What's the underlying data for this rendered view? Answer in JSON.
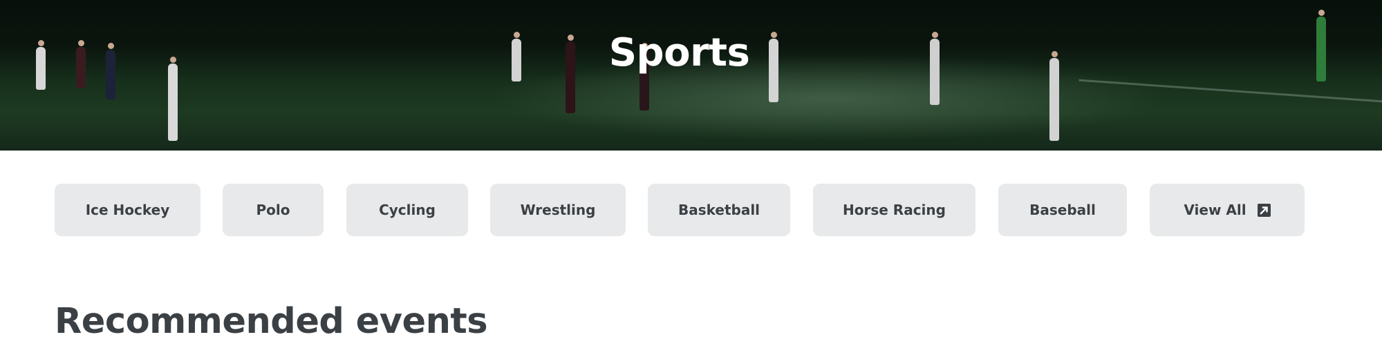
{
  "hero": {
    "title": "Sports"
  },
  "categories": [
    {
      "label": "Ice Hockey"
    },
    {
      "label": "Polo"
    },
    {
      "label": "Cycling"
    },
    {
      "label": "Wrestling"
    },
    {
      "label": "Basketball"
    },
    {
      "label": "Horse Racing"
    },
    {
      "label": "Baseball"
    },
    {
      "label": "View All",
      "icon": "external-link-icon"
    }
  ],
  "recommended": {
    "title": "Recommended events"
  },
  "colors": {
    "chip_background": "#e8e9ea",
    "text_dark": "#3b4045",
    "hero_title": "#ffffff"
  }
}
